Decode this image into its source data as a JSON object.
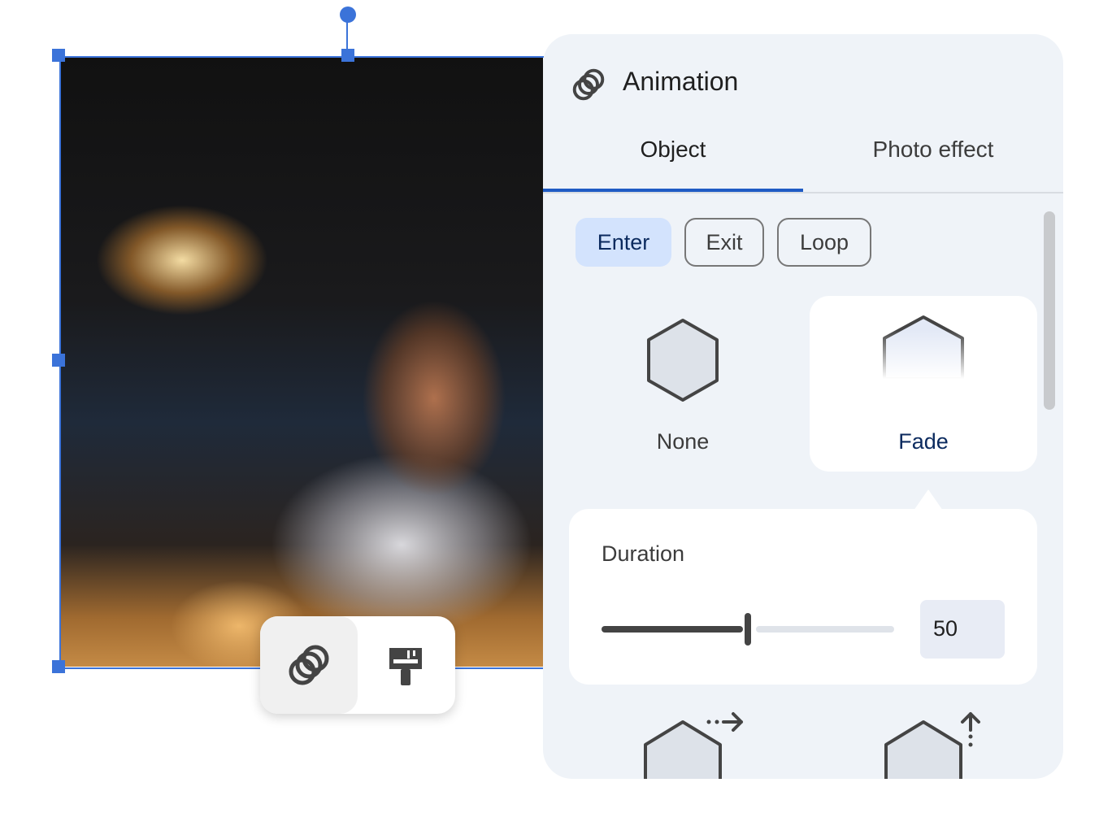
{
  "panel": {
    "title": "Animation",
    "title_icon": "animation-rings-icon",
    "tabs": [
      {
        "label": "Object",
        "active": true
      },
      {
        "label": "Photo effect",
        "active": false
      }
    ],
    "chips": [
      {
        "label": "Enter",
        "selected": true
      },
      {
        "label": "Exit",
        "selected": false
      },
      {
        "label": "Loop",
        "selected": false
      }
    ],
    "effects": [
      {
        "label": "None",
        "selected": false
      },
      {
        "label": "Fade",
        "selected": true
      }
    ],
    "duration": {
      "label": "Duration",
      "value": "50",
      "fraction": 0.5
    },
    "accent": "#1f5bc4"
  },
  "toolbar": {
    "items": [
      {
        "icon": "animation-rings-icon",
        "active": true
      },
      {
        "icon": "paintbrush-icon",
        "active": false
      }
    ]
  }
}
